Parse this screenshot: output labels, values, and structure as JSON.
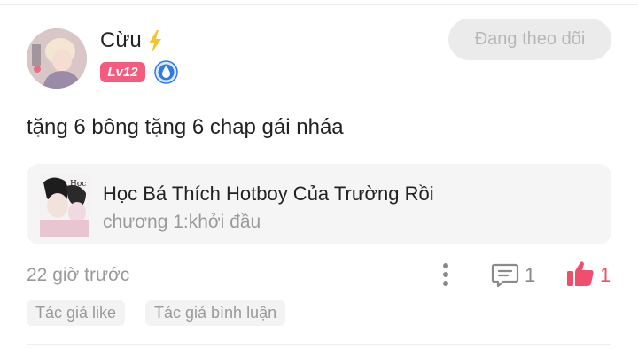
{
  "user": {
    "name": "Cừu",
    "level": "Lv12"
  },
  "follow_button": "Đang theo dõi",
  "comment": "tặng 6 bông tặng 6 chap gái nháa",
  "story": {
    "title": "Học Bá Thích Hotboy Của Trường Rồi",
    "chapter": "chương 1:khởi đầu",
    "cover_text": "Học"
  },
  "meta": {
    "timestamp": "22 giờ trước",
    "reply_count": "1",
    "like_count": "1"
  },
  "tags": [
    "Tác giả like",
    "Tác giả bình luận"
  ],
  "icons": {
    "verified": "lightning-bolt-icon",
    "rank": "water-drop-badge-icon",
    "more": "more-vertical-icon",
    "reply": "comment-bubble-icon",
    "like": "thumbs-up-icon"
  },
  "colors": {
    "accent": "#ef4f6d",
    "level_badge": "#f35c7f",
    "rank_badge": "#2f7de1",
    "bolt": "#f4c430"
  }
}
